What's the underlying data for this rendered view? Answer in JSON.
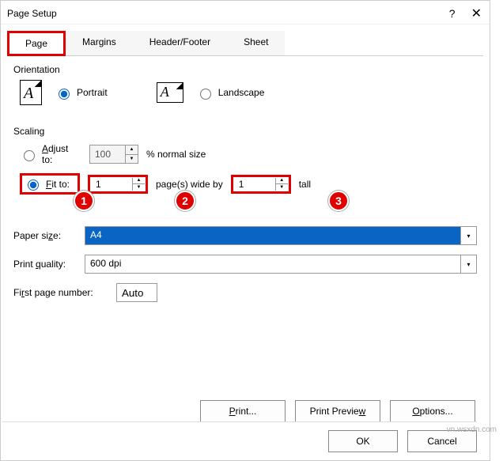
{
  "dialog": {
    "title": "Page Setup"
  },
  "tabs": {
    "page": "Page",
    "margins": "Margins",
    "header_footer": "Header/Footer",
    "sheet": "Sheet"
  },
  "orientation": {
    "label": "Orientation",
    "portrait": "Portrait",
    "landscape": "Landscape"
  },
  "scaling": {
    "label": "Scaling",
    "adjust_to": "Adjust to:",
    "adjust_value": "100",
    "adjust_suffix": "% normal size",
    "fit_to": "Fit to:",
    "wide_value": "1",
    "wide_suffix": "page(s) wide by",
    "tall_value": "1",
    "tall_suffix": "tall"
  },
  "paper_size": {
    "label": "Paper size:",
    "value": "A4"
  },
  "print_quality": {
    "label": "Print quality:",
    "value": "600 dpi"
  },
  "first_page": {
    "label": "First page number:",
    "value": "Auto"
  },
  "buttons": {
    "print": "Print...",
    "print_preview": "Print Preview",
    "options": "Options...",
    "ok": "OK",
    "cancel": "Cancel"
  },
  "callouts": {
    "c1": "1",
    "c2": "2",
    "c3": "3"
  },
  "watermark": "vn.wsxdn.com"
}
